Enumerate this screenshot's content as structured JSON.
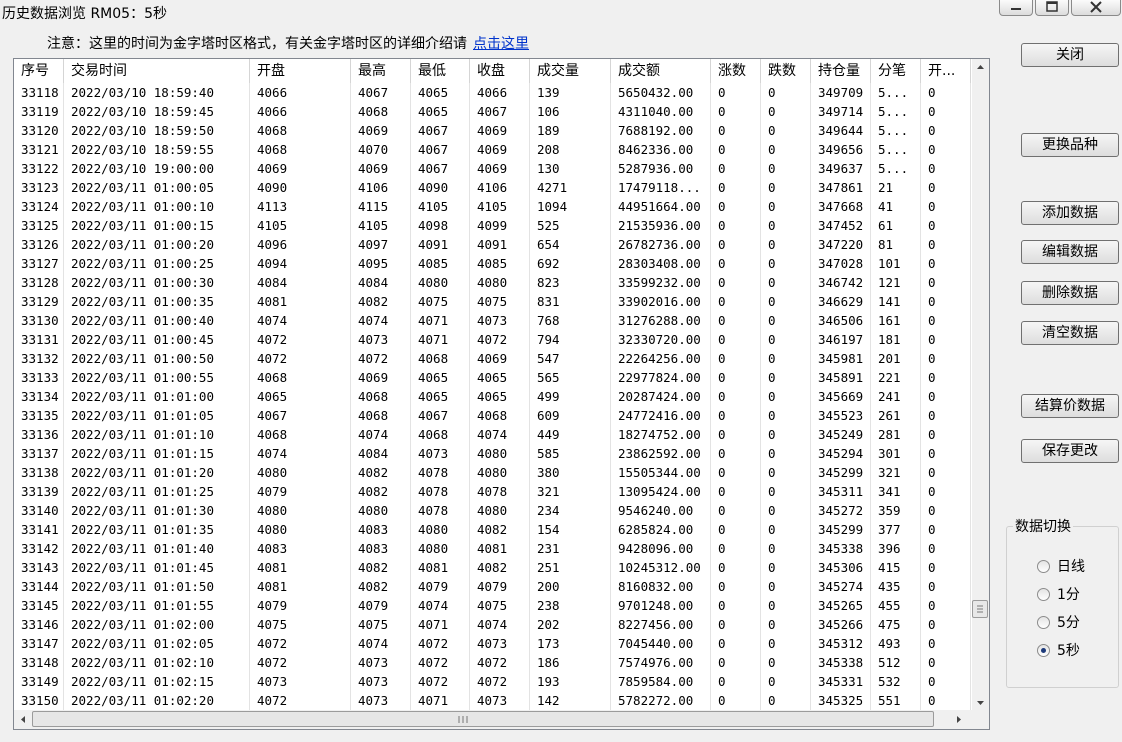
{
  "window": {
    "title": "历史数据浏览 RM05：5秒"
  },
  "notice": {
    "text": "注意：这里的时间为金字塔时区格式，有关金字塔时区的详细介绍请",
    "link": "点击这里"
  },
  "table": {
    "columns": [
      "序号",
      "交易时间",
      "开盘",
      "最高",
      "最低",
      "收盘",
      "成交量",
      "成交额",
      "涨数",
      "跌数",
      "持仓量",
      "分笔",
      "开..."
    ],
    "rows": [
      [
        "33118",
        "2022/03/10 18:59:40",
        "4066",
        "4067",
        "4065",
        "4066",
        "139",
        "5650432.00",
        "0",
        "0",
        "349709",
        "5...",
        "0"
      ],
      [
        "33119",
        "2022/03/10 18:59:45",
        "4066",
        "4068",
        "4065",
        "4067",
        "106",
        "4311040.00",
        "0",
        "0",
        "349714",
        "5...",
        "0"
      ],
      [
        "33120",
        "2022/03/10 18:59:50",
        "4068",
        "4069",
        "4067",
        "4069",
        "189",
        "7688192.00",
        "0",
        "0",
        "349644",
        "5...",
        "0"
      ],
      [
        "33121",
        "2022/03/10 18:59:55",
        "4068",
        "4070",
        "4067",
        "4069",
        "208",
        "8462336.00",
        "0",
        "0",
        "349656",
        "5...",
        "0"
      ],
      [
        "33122",
        "2022/03/10 19:00:00",
        "4069",
        "4069",
        "4067",
        "4069",
        "130",
        "5287936.00",
        "0",
        "0",
        "349637",
        "5...",
        "0"
      ],
      [
        "33123",
        "2022/03/11 01:00:05",
        "4090",
        "4106",
        "4090",
        "4106",
        "4271",
        "17479118...",
        "0",
        "0",
        "347861",
        "21",
        "0"
      ],
      [
        "33124",
        "2022/03/11 01:00:10",
        "4113",
        "4115",
        "4105",
        "4105",
        "1094",
        "44951664.00",
        "0",
        "0",
        "347668",
        "41",
        "0"
      ],
      [
        "33125",
        "2022/03/11 01:00:15",
        "4105",
        "4105",
        "4098",
        "4099",
        "525",
        "21535936.00",
        "0",
        "0",
        "347452",
        "61",
        "0"
      ],
      [
        "33126",
        "2022/03/11 01:00:20",
        "4096",
        "4097",
        "4091",
        "4091",
        "654",
        "26782736.00",
        "0",
        "0",
        "347220",
        "81",
        "0"
      ],
      [
        "33127",
        "2022/03/11 01:00:25",
        "4094",
        "4095",
        "4085",
        "4085",
        "692",
        "28303408.00",
        "0",
        "0",
        "347028",
        "101",
        "0"
      ],
      [
        "33128",
        "2022/03/11 01:00:30",
        "4084",
        "4084",
        "4080",
        "4080",
        "823",
        "33599232.00",
        "0",
        "0",
        "346742",
        "121",
        "0"
      ],
      [
        "33129",
        "2022/03/11 01:00:35",
        "4081",
        "4082",
        "4075",
        "4075",
        "831",
        "33902016.00",
        "0",
        "0",
        "346629",
        "141",
        "0"
      ],
      [
        "33130",
        "2022/03/11 01:00:40",
        "4074",
        "4074",
        "4071",
        "4073",
        "768",
        "31276288.00",
        "0",
        "0",
        "346506",
        "161",
        "0"
      ],
      [
        "33131",
        "2022/03/11 01:00:45",
        "4072",
        "4073",
        "4071",
        "4072",
        "794",
        "32330720.00",
        "0",
        "0",
        "346197",
        "181",
        "0"
      ],
      [
        "33132",
        "2022/03/11 01:00:50",
        "4072",
        "4072",
        "4068",
        "4069",
        "547",
        "22264256.00",
        "0",
        "0",
        "345981",
        "201",
        "0"
      ],
      [
        "33133",
        "2022/03/11 01:00:55",
        "4068",
        "4069",
        "4065",
        "4065",
        "565",
        "22977824.00",
        "0",
        "0",
        "345891",
        "221",
        "0"
      ],
      [
        "33134",
        "2022/03/11 01:01:00",
        "4065",
        "4068",
        "4065",
        "4065",
        "499",
        "20287424.00",
        "0",
        "0",
        "345669",
        "241",
        "0"
      ],
      [
        "33135",
        "2022/03/11 01:01:05",
        "4067",
        "4068",
        "4067",
        "4068",
        "609",
        "24772416.00",
        "0",
        "0",
        "345523",
        "261",
        "0"
      ],
      [
        "33136",
        "2022/03/11 01:01:10",
        "4068",
        "4074",
        "4068",
        "4074",
        "449",
        "18274752.00",
        "0",
        "0",
        "345249",
        "281",
        "0"
      ],
      [
        "33137",
        "2022/03/11 01:01:15",
        "4074",
        "4084",
        "4073",
        "4080",
        "585",
        "23862592.00",
        "0",
        "0",
        "345294",
        "301",
        "0"
      ],
      [
        "33138",
        "2022/03/11 01:01:20",
        "4080",
        "4082",
        "4078",
        "4080",
        "380",
        "15505344.00",
        "0",
        "0",
        "345299",
        "321",
        "0"
      ],
      [
        "33139",
        "2022/03/11 01:01:25",
        "4079",
        "4082",
        "4078",
        "4078",
        "321",
        "13095424.00",
        "0",
        "0",
        "345311",
        "341",
        "0"
      ],
      [
        "33140",
        "2022/03/11 01:01:30",
        "4080",
        "4080",
        "4078",
        "4080",
        "234",
        "9546240.00",
        "0",
        "0",
        "345272",
        "359",
        "0"
      ],
      [
        "33141",
        "2022/03/11 01:01:35",
        "4080",
        "4083",
        "4080",
        "4082",
        "154",
        "6285824.00",
        "0",
        "0",
        "345299",
        "377",
        "0"
      ],
      [
        "33142",
        "2022/03/11 01:01:40",
        "4083",
        "4083",
        "4080",
        "4081",
        "231",
        "9428096.00",
        "0",
        "0",
        "345338",
        "396",
        "0"
      ],
      [
        "33143",
        "2022/03/11 01:01:45",
        "4081",
        "4082",
        "4081",
        "4082",
        "251",
        "10245312.00",
        "0",
        "0",
        "345306",
        "415",
        "0"
      ],
      [
        "33144",
        "2022/03/11 01:01:50",
        "4081",
        "4082",
        "4079",
        "4079",
        "200",
        "8160832.00",
        "0",
        "0",
        "345274",
        "435",
        "0"
      ],
      [
        "33145",
        "2022/03/11 01:01:55",
        "4079",
        "4079",
        "4074",
        "4075",
        "238",
        "9701248.00",
        "0",
        "0",
        "345265",
        "455",
        "0"
      ],
      [
        "33146",
        "2022/03/11 01:02:00",
        "4075",
        "4075",
        "4071",
        "4074",
        "202",
        "8227456.00",
        "0",
        "0",
        "345266",
        "475",
        "0"
      ],
      [
        "33147",
        "2022/03/11 01:02:05",
        "4072",
        "4074",
        "4072",
        "4073",
        "173",
        "7045440.00",
        "0",
        "0",
        "345312",
        "493",
        "0"
      ],
      [
        "33148",
        "2022/03/11 01:02:10",
        "4072",
        "4073",
        "4072",
        "4072",
        "186",
        "7574976.00",
        "0",
        "0",
        "345338",
        "512",
        "0"
      ],
      [
        "33149",
        "2022/03/11 01:02:15",
        "4073",
        "4073",
        "4072",
        "4072",
        "193",
        "7859584.00",
        "0",
        "0",
        "345331",
        "532",
        "0"
      ],
      [
        "33150",
        "2022/03/11 01:02:20",
        "4072",
        "4073",
        "4071",
        "4073",
        "142",
        "5782272.00",
        "0",
        "0",
        "345325",
        "551",
        "0"
      ]
    ]
  },
  "buttons": {
    "close": "关闭",
    "change_symbol": "更换品种",
    "add_data": "添加数据",
    "edit_data": "编辑数据",
    "delete_data": "删除数据",
    "clear_data": "清空数据",
    "settlement_data": "结算价数据",
    "save_changes": "保存更改"
  },
  "data_switch": {
    "title": "数据切换",
    "options": [
      "日线",
      "1分",
      "5分",
      "5秒"
    ],
    "selected": "5秒"
  }
}
